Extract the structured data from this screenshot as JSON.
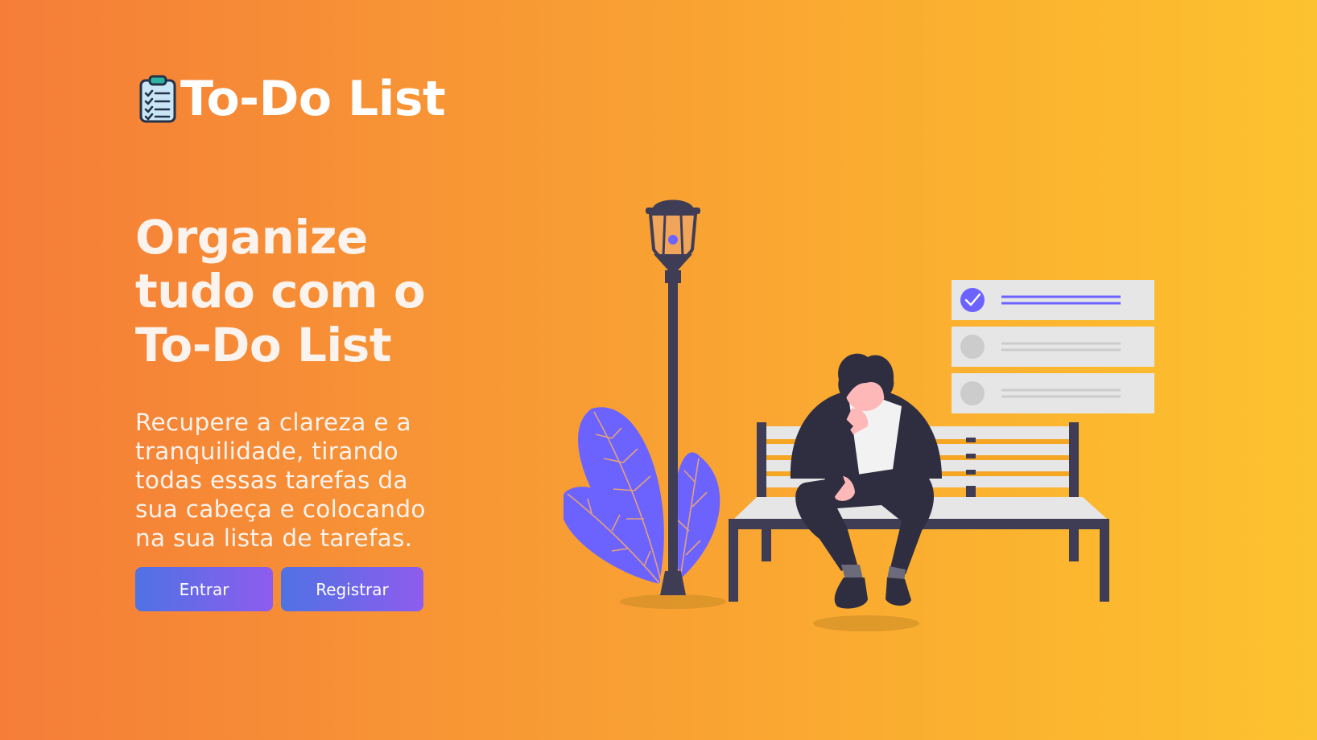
{
  "app": {
    "title": "To-Do List",
    "logo_icon": "clipboard-checklist-icon"
  },
  "hero": {
    "headline": "Organize tudo com o To-Do List",
    "subtitle": "Recupere a clareza e a tranquilidade, tirando todas essas tarefas da sua cabeça e colocando na sua lista de tarefas."
  },
  "actions": {
    "login_label": "Entrar",
    "register_label": "Registrar"
  },
  "illustration": {
    "scene": "person-on-bench-with-task-list",
    "tasks_total": 3,
    "tasks_done": 1
  },
  "colors": {
    "background_start": "#f57d38",
    "background_end": "#fdc22f",
    "button_start": "#4f72e3",
    "button_end": "#8e5cee",
    "accent": "#6c63ff",
    "dark": "#3f3d56"
  }
}
